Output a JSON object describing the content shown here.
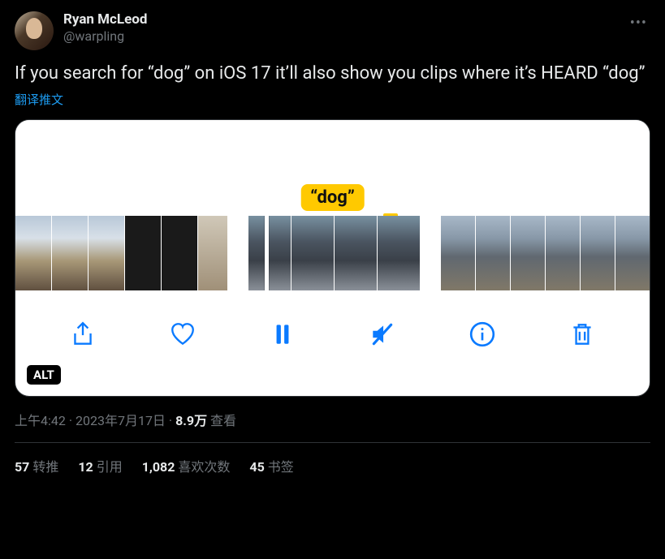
{
  "author": {
    "display_name": "Ryan McLeod",
    "handle": "@warpling"
  },
  "tweet_text": "If you search for “dog” on iOS 17 it’ll also show you clips where it’s HEARD “dog”",
  "translate_label": "翻译推文",
  "media": {
    "caption_label": "“dog”",
    "alt_badge": "ALT"
  },
  "timestamp": {
    "time": "上午4:42",
    "separator": " · ",
    "date": "2023年7月17日",
    "views_count": "8.9万",
    "views_label": " 查看"
  },
  "stats": {
    "retweets_count": "57",
    "retweets_label": "转推",
    "quotes_count": "12",
    "quotes_label": "引用",
    "likes_count": "1,082",
    "likes_label": "喜欢次数",
    "bookmarks_count": "45",
    "bookmarks_label": "书签"
  }
}
